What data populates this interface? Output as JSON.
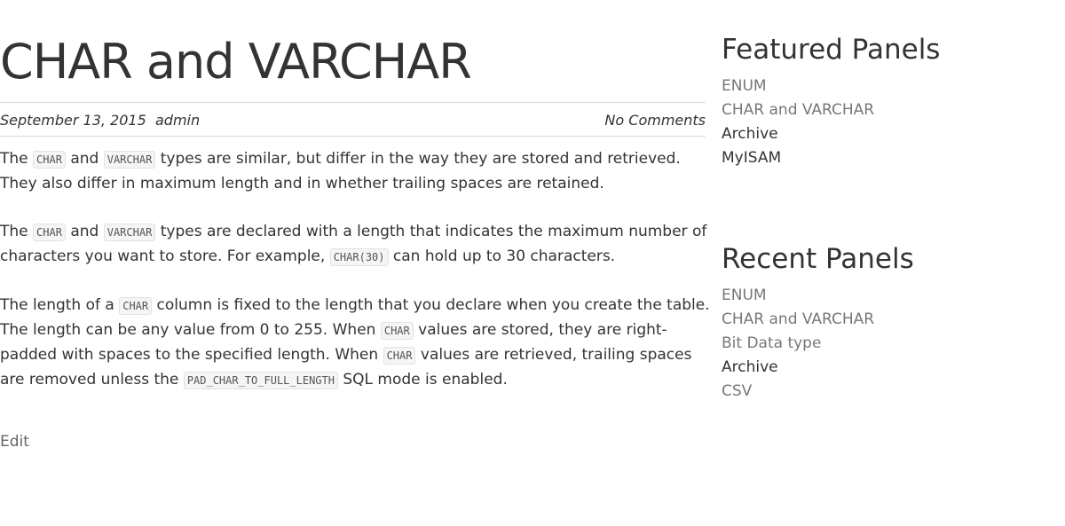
{
  "post": {
    "title": "CHAR and VARCHAR",
    "date": "September 13, 2015",
    "author": "admin",
    "comments": "No Comments",
    "edit": "Edit",
    "p1": {
      "t1": "The ",
      "c1": "CHAR",
      "t2": " and ",
      "c2": "VARCHAR",
      "t3": " types are similar, but differ in the way they are stored and retrieved. They also differ in maximum length and in whether trailing spaces are retained."
    },
    "p2": {
      "t1": "The ",
      "c1": "CHAR",
      "t2": " and ",
      "c2": "VARCHAR",
      "t3": " types are declared with a length that indicates the maximum number of characters you want to store. For example, ",
      "c3": "CHAR(30)",
      "t4": " can hold up to 30 characters."
    },
    "p3": {
      "t1": "The length of a ",
      "c1": "CHAR",
      "t2": " column is fixed to the length that you declare when you create the table. The length can be any value from 0 to 255. When ",
      "c2": "CHAR",
      "t3": " values are stored, they are right-padded with spaces to the specified length. When ",
      "c3": "CHAR",
      "t4": " values are retrieved, trailing spaces are removed unless the ",
      "c4": "PAD_CHAR_TO_FULL_LENGTH",
      "t5": " SQL mode is enabled."
    }
  },
  "sidebar": {
    "featured": {
      "title": "Featured Panels",
      "items": [
        "ENUM",
        "CHAR and VARCHAR",
        "Archive",
        "MyISAM"
      ]
    },
    "recent": {
      "title": "Recent Panels",
      "items": [
        "ENUM",
        "CHAR and VARCHAR",
        "Bit Data type",
        "Archive",
        "CSV"
      ]
    }
  }
}
